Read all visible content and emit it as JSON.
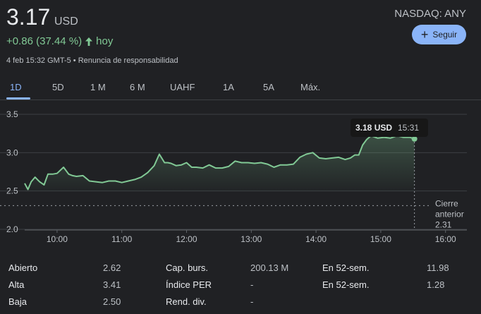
{
  "quote": {
    "price": "3.17",
    "currency": "USD",
    "exchange_ticker": "NASDAQ: ANY",
    "change": "+0.86 (37.44 %)",
    "change_period": "hoy",
    "timestamp": "4 feb 15:32 GMT-5",
    "separator": "•",
    "disclaimer": "Renuncia de responsabilidad",
    "up_color": "#81c995"
  },
  "follow_button": {
    "label": "Seguir",
    "icon": "plus-icon"
  },
  "tabs": [
    {
      "label": "1D",
      "active": true
    },
    {
      "label": "5D",
      "active": false
    },
    {
      "label": "1 M",
      "active": false
    },
    {
      "label": "6 M",
      "active": false
    },
    {
      "label": "UAHF",
      "active": false
    },
    {
      "label": "1A",
      "active": false
    },
    {
      "label": "5A",
      "active": false
    },
    {
      "label": "Máx.",
      "active": false
    }
  ],
  "chart_data": {
    "type": "area",
    "y_ticks": [
      "3.5",
      "3.0",
      "2.5",
      "2.0"
    ],
    "ylim": [
      2.0,
      3.5
    ],
    "x_ticks": [
      "10:00",
      "11:00",
      "12:00",
      "13:00",
      "14:00",
      "15:00",
      "16:00"
    ],
    "x_tick_hours": [
      10,
      11,
      12,
      13,
      14,
      15,
      16
    ],
    "xlim_hours": [
      9.5,
      16.33
    ],
    "grid": true,
    "line_color": "#81c995",
    "previous_close": {
      "label_line1": "Cierre",
      "label_line2": "anterior",
      "value": "2.31",
      "value_num": 2.31
    },
    "tooltip": {
      "price": "3.18 USD",
      "time": "15:31",
      "hour": 15.52,
      "value": 3.18
    },
    "series": [
      {
        "x": [
          9.5,
          9.55,
          9.6,
          9.66,
          9.73,
          9.8,
          9.86,
          9.93,
          10.0,
          10.1,
          10.18,
          10.24,
          10.3,
          10.4,
          10.5,
          10.6,
          10.7,
          10.8,
          10.9,
          11.0,
          11.1,
          11.2,
          11.3,
          11.4,
          11.5,
          11.58,
          11.66,
          11.71,
          11.76,
          11.84,
          11.92,
          12.0,
          12.08,
          12.15,
          12.25,
          12.35,
          12.45,
          12.55,
          12.65,
          12.75,
          12.85,
          12.95,
          13.05,
          13.15,
          13.25,
          13.35,
          13.45,
          13.55,
          13.65,
          13.75,
          13.85,
          13.95,
          14.05,
          14.15,
          14.25,
          14.35,
          14.45,
          14.53,
          14.6,
          14.66,
          14.72,
          14.78,
          14.85,
          14.95,
          15.05,
          15.15,
          15.25,
          15.35,
          15.45,
          15.52
        ],
        "values": [
          2.6,
          2.52,
          2.62,
          2.68,
          2.62,
          2.58,
          2.72,
          2.72,
          2.73,
          2.81,
          2.72,
          2.7,
          2.69,
          2.7,
          2.63,
          2.62,
          2.61,
          2.63,
          2.63,
          2.61,
          2.63,
          2.65,
          2.68,
          2.74,
          2.83,
          2.98,
          2.87,
          2.87,
          2.86,
          2.83,
          2.84,
          2.87,
          2.81,
          2.81,
          2.8,
          2.84,
          2.8,
          2.8,
          2.82,
          2.89,
          2.87,
          2.87,
          2.86,
          2.87,
          2.85,
          2.81,
          2.84,
          2.84,
          2.85,
          2.94,
          2.98,
          3.0,
          2.93,
          2.92,
          2.93,
          2.94,
          2.91,
          2.93,
          2.97,
          2.97,
          3.1,
          3.17,
          3.22,
          3.19,
          3.2,
          3.19,
          3.22,
          3.2,
          3.2,
          3.18
        ]
      }
    ]
  },
  "stats": [
    {
      "label": "Abierto",
      "value": "2.62"
    },
    {
      "label": "Alta",
      "value": "3.41"
    },
    {
      "label": "Baja",
      "value": "2.50"
    },
    {
      "label": "Cap. burs.",
      "value": "200.13 M"
    },
    {
      "label": "Índice PER",
      "value": "-"
    },
    {
      "label": "Rend. div.",
      "value": "-"
    },
    {
      "label": "En 52-sem.",
      "value": "11.98"
    },
    {
      "label": "En 52-sem.",
      "value": "1.28"
    }
  ]
}
